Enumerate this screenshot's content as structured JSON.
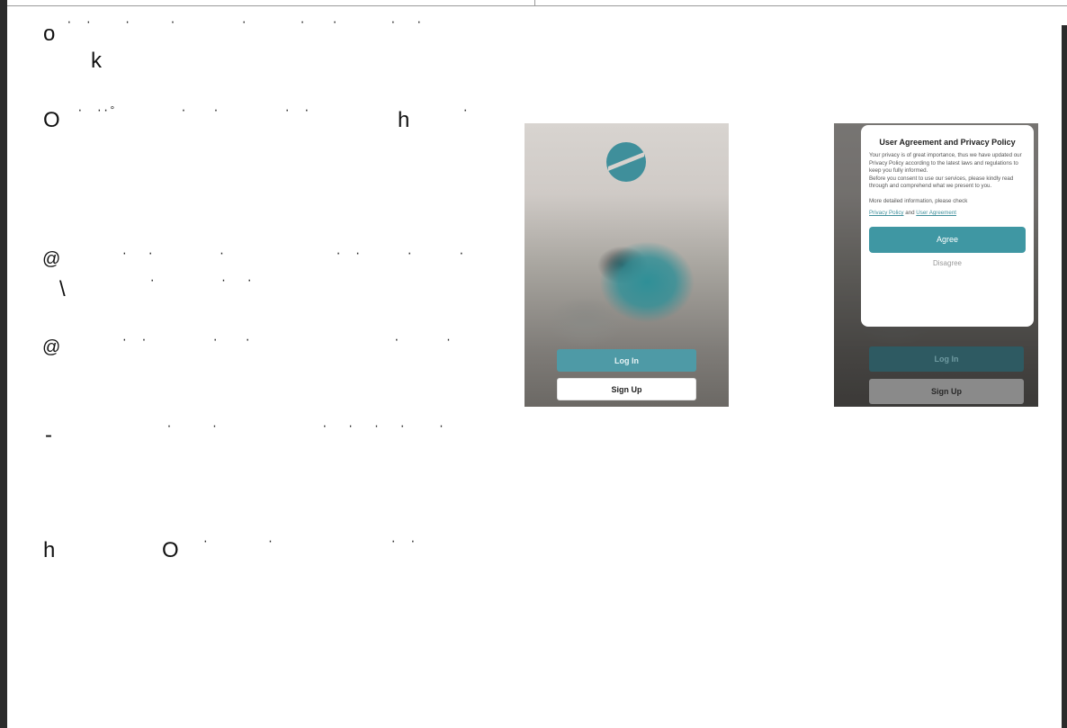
{
  "document": {
    "garbled_lines": [
      {
        "glyph": "o",
        "tail": " ·  ·     ·      ·          ·        ·    ·        ·   ·"
      },
      {
        "glyph": "k",
        "tail": ""
      },
      {
        "glyph": "O",
        "tail": " ·  ··°          ·    ·          ·  ·"
      },
      {
        "glyph": "h",
        "tail": "        ·"
      },
      {
        "glyph": "@",
        "tail": "         ·   ·          ·                 ·  ·       ·       ·"
      },
      {
        "glyph": "\\",
        "tail": "             ·          ·   ·"
      },
      {
        "glyph": "@",
        "tail": "         ·  ·          ·    ·                      ·       ·"
      },
      {
        "glyph": "-",
        "tail": "                 ·      ·                ·   ·   ·   ·     ·"
      },
      {
        "glyph": "h",
        "tail": ""
      },
      {
        "glyph": "O",
        "tail": "    ·         ·                  ·  ·"
      }
    ]
  },
  "screens": {
    "first": {
      "login_label": "Log In",
      "signup_label": "Sign Up"
    },
    "second": {
      "modal_title": "User Agreement and Privacy Policy",
      "modal_paragraph_1": "Your privacy is of great importance, thus we have updated our Privacy Policy according to the latest laws and regulations to keep you fully informed.",
      "modal_paragraph_2": "Before you consent to use our services, please kindly read through and comprehend what we present to you.",
      "modal_more": "More detailed information, please check",
      "privacy_link": "Privacy Policy",
      "and_text": " and ",
      "agreement_link": "User Agreement",
      "agree_label": "Agree",
      "disagree_label": "Disagree",
      "login_label": "Log In",
      "signup_label": "Sign Up"
    }
  },
  "colors": {
    "accent": "#3f97a3",
    "frame": "#2b2b2b"
  }
}
